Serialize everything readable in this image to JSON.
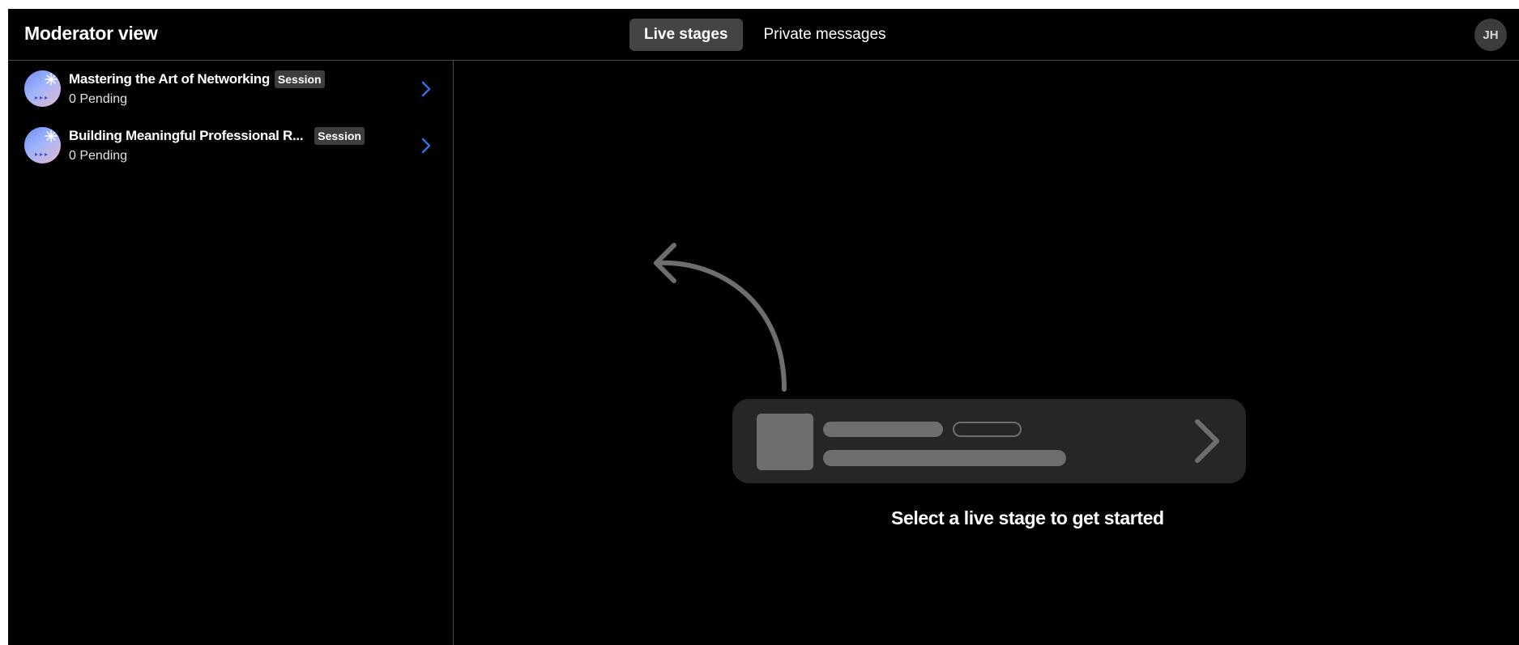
{
  "header": {
    "title": "Moderator view",
    "tabs": [
      {
        "label": "Live stages",
        "active": true
      },
      {
        "label": "Private messages",
        "active": false
      }
    ],
    "avatar_initials": "JH"
  },
  "stages": [
    {
      "title": "Mastering the Art of Networking",
      "badge": "Session",
      "pending": "0 Pending"
    },
    {
      "title": "Building Meaningful Professional R...",
      "badge": "Session",
      "pending": "0 Pending"
    }
  ],
  "empty_state": {
    "caption": "Select a live stage to get started"
  },
  "colors": {
    "background": "#000000",
    "active_tab": "#444444",
    "chevron_accent": "#2f6fe0",
    "placeholder_gray": "#6e6e6e"
  },
  "icons": {
    "stage_chevron": "chevron-right-icon",
    "hint_arrow": "curved-arrow-icon"
  }
}
